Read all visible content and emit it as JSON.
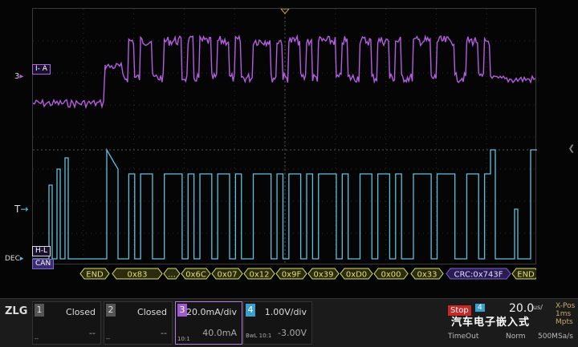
{
  "screen": {
    "background": "#050505"
  },
  "traces": {
    "ch3_color": "#b35de0",
    "decode_color": "#60c0dc",
    "bus_fill": "#2b2b10",
    "bus_border": "#d8e070",
    "bus_text": "#e0e070"
  },
  "markers": {
    "ch3": "3",
    "ch3_box": "I- A",
    "trigger": "T",
    "dec": "DEC",
    "hl": "H-L",
    "can": "CAN"
  },
  "decode_frames": [
    "END",
    "0x83",
    "...",
    "0x6C",
    "0x07",
    "0x12",
    "0x9F",
    "0x39",
    "0xD0",
    "0x00",
    "0x33",
    "CRC:0x743F",
    "END"
  ],
  "channels": [
    {
      "num": "1",
      "label": "Closed",
      "sub": "--",
      "sub2": "--"
    },
    {
      "num": "2",
      "label": "Closed",
      "sub": "--",
      "sub2": "--"
    },
    {
      "num": "3",
      "label": "20.0mA/div",
      "sub": "40.0mA",
      "tag": "10:1"
    },
    {
      "num": "4",
      "label": "1.00V/div",
      "sub": "-3.00V",
      "tag": "BwL 10:1"
    }
  ],
  "status": {
    "state": "Stop",
    "trigger_channel": "4",
    "timebase": "20.0",
    "timebase_unit": "us/",
    "xpos": "X-Pos",
    "xpos_val": "1ms",
    "pts": "Mpts",
    "timeout": "TimeOut",
    "mode": "Norm",
    "rate": "500MSa/s"
  },
  "watermark": "汽车电子嵌入式",
  "logo": "ZLG"
}
